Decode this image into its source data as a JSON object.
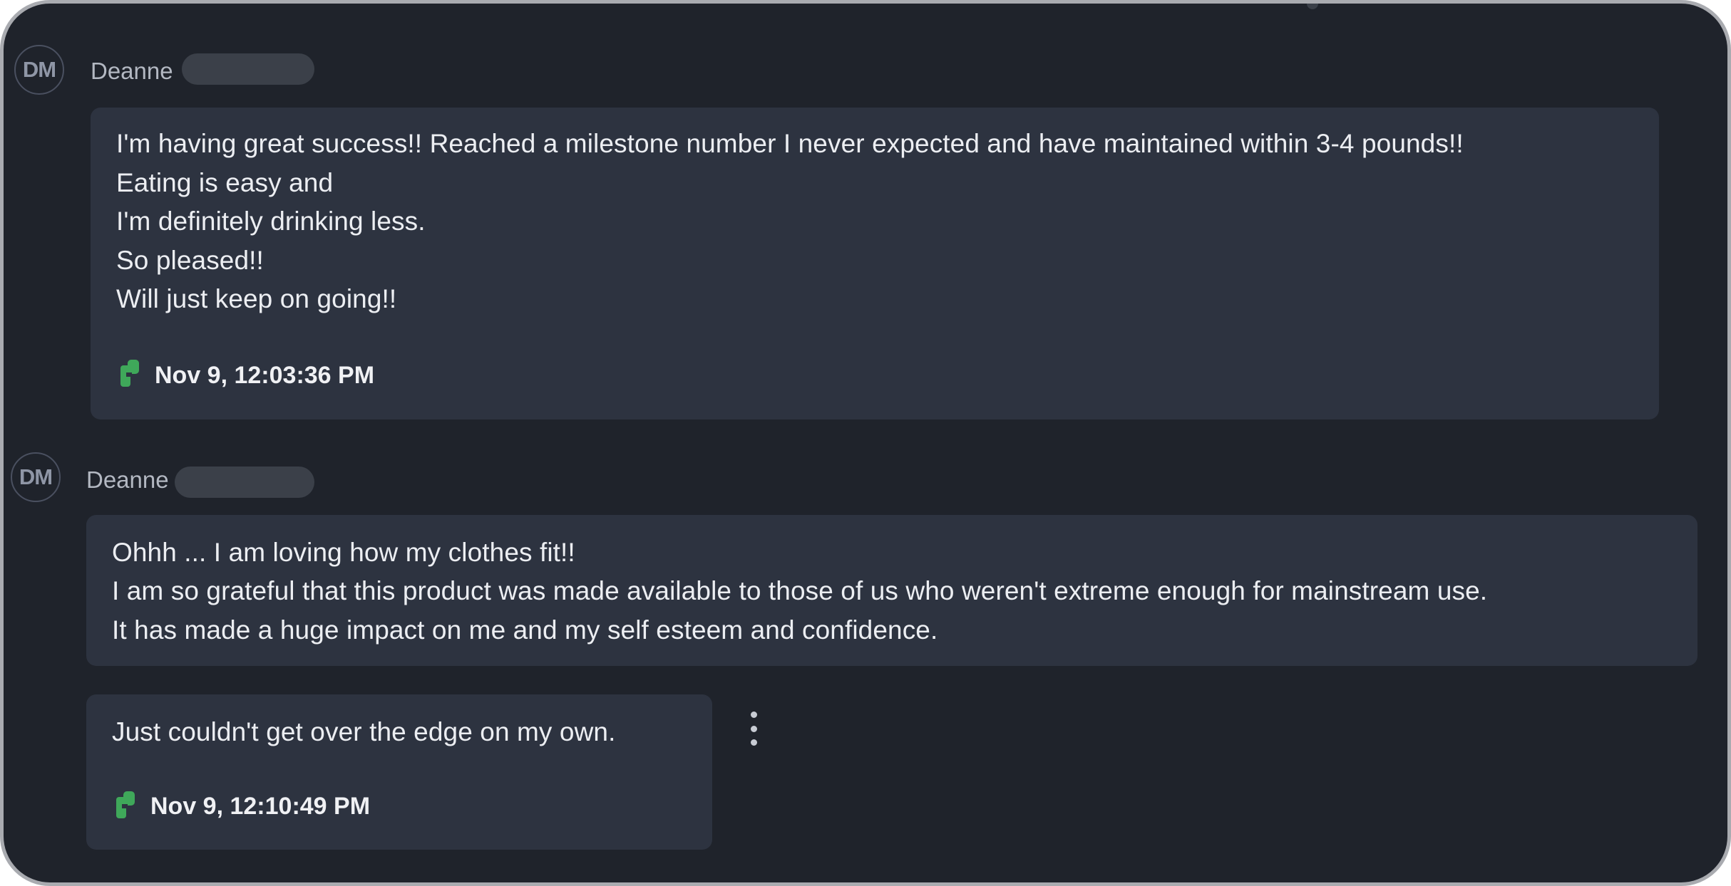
{
  "messages": [
    {
      "avatar_initials": "DM",
      "sender_name": "Deanne",
      "lines": [
        "I'm having great success!! Reached a milestone number I never expected and have maintained within 3-4 pounds!!",
        "Eating is easy and",
        "I'm definitely drinking less.",
        "So pleased!!",
        "Will just keep on going!!"
      ],
      "timestamp": "Nov 9, 12:03:36 PM",
      "status_icon": "sent-status-icon"
    },
    {
      "avatar_initials": "DM",
      "sender_name": "Deanne",
      "lines": [
        "Ohhh ... I am loving how my clothes fit!!",
        "I am so grateful that this product was made available to those of us who weren't extreme enough for mainstream use.",
        "It has made a huge impact on me and my self esteem and confidence."
      ]
    },
    {
      "lines": [
        "Just couldn't get over the edge on my own."
      ],
      "timestamp": "Nov 9, 12:10:49 PM",
      "status_icon": "sent-status-icon",
      "menu_icon": "more-options-icon"
    }
  ],
  "colors": {
    "background": "#1f232b",
    "bubble": "#2d3340",
    "status_green": "#3fa85a"
  }
}
